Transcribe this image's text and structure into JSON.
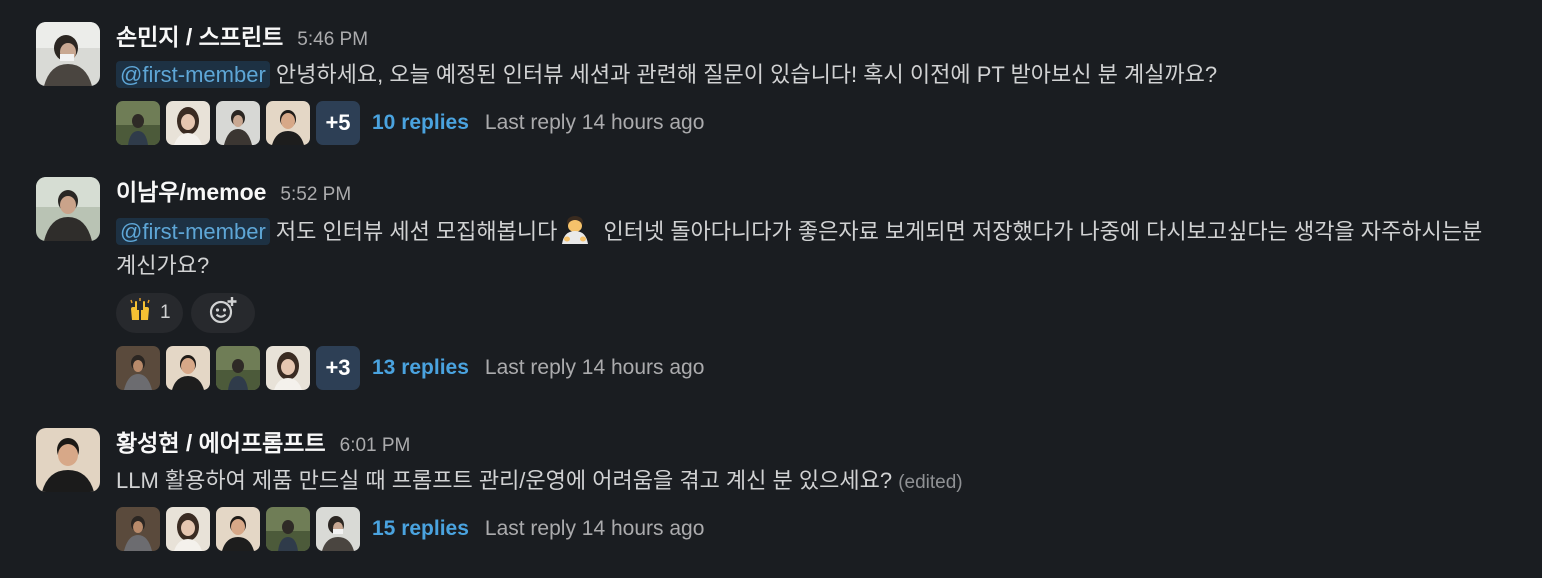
{
  "messages": [
    {
      "author": "손민지 / 스프린트",
      "time": "5:46 PM",
      "mention": "@first-member",
      "text": " 안녕하세요, 오늘 예정된 인터뷰 세션과 관련해 질문이 있습니다! 혹시 이전에 PT 받아보신 분 계실까요?",
      "thread": {
        "more": "+5",
        "replies": "10 replies",
        "last_reply": "Last reply 14 hours ago"
      }
    },
    {
      "author": "이남우/memoe",
      "time": "5:52 PM",
      "mention": "@first-member",
      "text_before_emoji": " 저도 인터뷰 세션 모집해봅니다",
      "emoji": "bowing-person-emoji",
      "text_after_emoji": " 인터넷 돌아다니다가 좋은자료 보게되면 저장했다가 나중에 다시보고싶다는 생각을 자주하시는분 계신가요?",
      "reactions": [
        {
          "emoji": "raising-hands-emoji",
          "count": "1"
        }
      ],
      "add_reaction_icon": "add-reaction-icon",
      "thread": {
        "more": "+3",
        "replies": "13 replies",
        "last_reply": "Last reply 14 hours ago"
      }
    },
    {
      "author": "황성현 / 에어프롬프트",
      "time": "6:01 PM",
      "text": "LLM 활용하여 제품 만드실 때 프롬프트 관리/운영에 어려움을 겪고 계신 분 있으세요? ",
      "edited": "(edited)",
      "thread": {
        "replies": "15 replies",
        "last_reply": "Last reply 14 hours ago"
      }
    }
  ],
  "colors": {
    "background": "#1a1d21",
    "mention_bg": "#1d3143",
    "mention_text": "#5ea6d6",
    "link": "#4aa3df"
  }
}
